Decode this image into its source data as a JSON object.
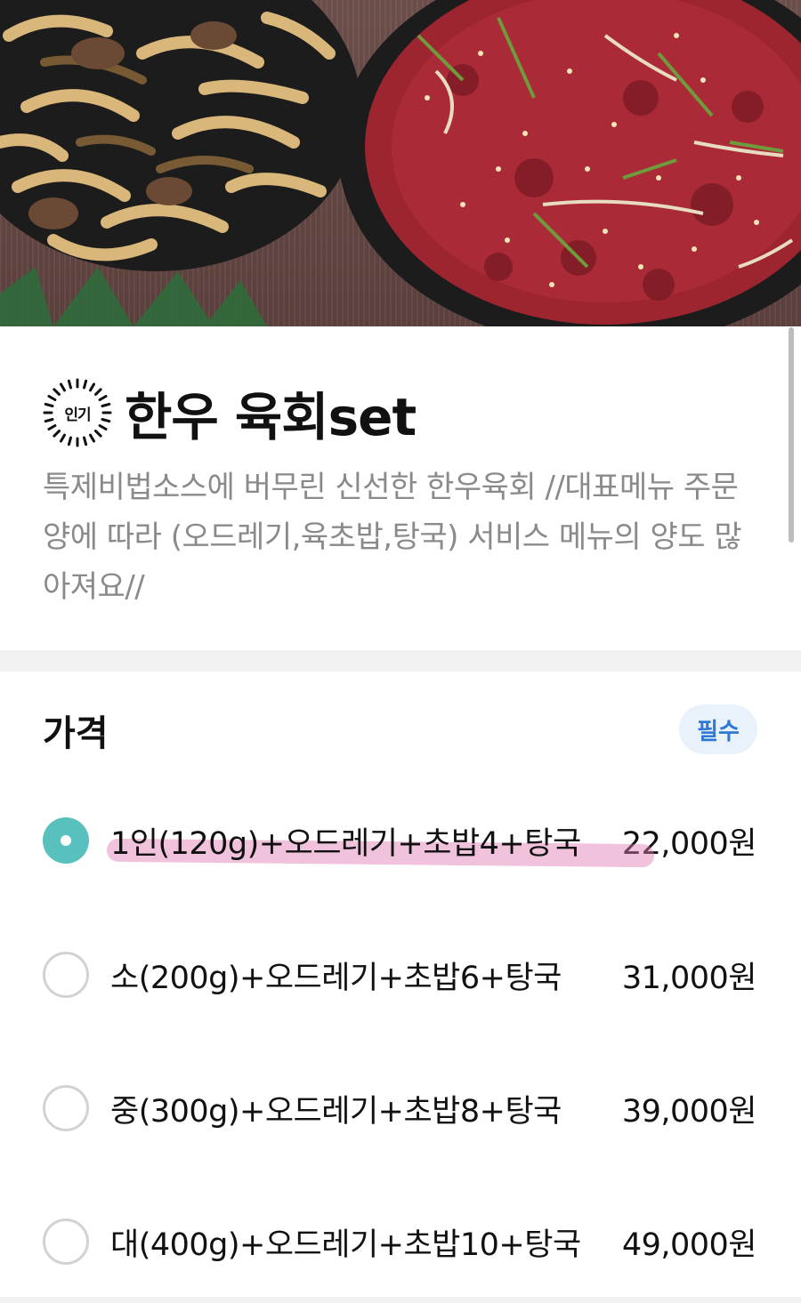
{
  "menu": {
    "badge": "인기",
    "title": "한우 육회set",
    "description": "특제비법소스에 버무린 신선한 한우육회 //대표메뉴 주문양에 따라 (오드레기,육초밥,탕국) 서비스 메뉴의 양도 많아져요//"
  },
  "price_section": {
    "title": "가격",
    "required_label": "필수",
    "options": [
      {
        "label": "1인(120g)+오드레기+초밥4+탕국",
        "price": "22,000원",
        "selected": true
      },
      {
        "label": "소(200g)+오드레기+초밥6+탕국",
        "price": "31,000원",
        "selected": false
      },
      {
        "label": "중(300g)+오드레기+초밥8+탕국",
        "price": "39,000원",
        "selected": false
      },
      {
        "label": "대(400g)+오드레기+초밥10+탕국",
        "price": "49,000원",
        "selected": false
      }
    ]
  },
  "colors": {
    "radio_selected": "#58c1bd",
    "required_badge_bg": "#e9f2fb",
    "required_badge_text": "#2f78d3",
    "description_text": "#8a8a8a",
    "highlight_mark": "#e178af"
  },
  "icons": [
    "popular-badge-icon",
    "radio-selected-icon",
    "radio-empty-icon"
  ]
}
